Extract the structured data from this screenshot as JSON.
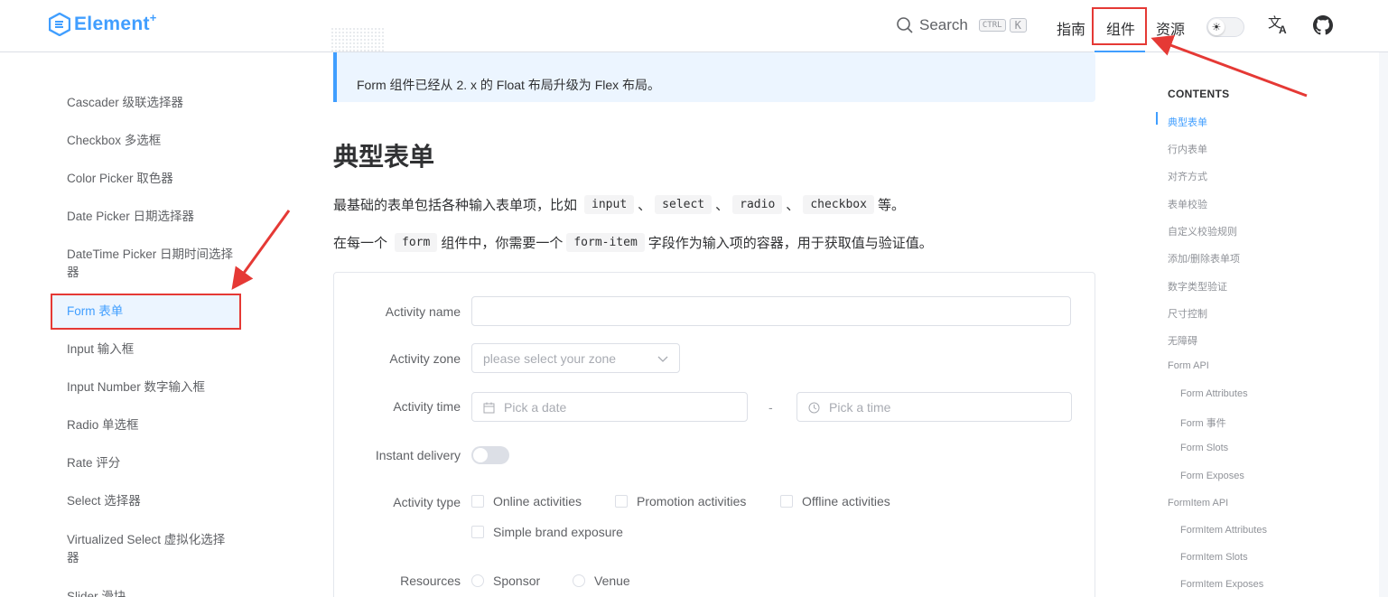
{
  "header": {
    "logo_text": "Element",
    "logo_plus": "+",
    "search_label": "Search",
    "kbd_ctrl": "CTRL",
    "kbd_k": "K",
    "nav": [
      "指南",
      "组件",
      "资源"
    ],
    "active_nav": "组件"
  },
  "sidebar": {
    "items": [
      "Cascader 级联选择器",
      "Checkbox 多选框",
      "Color Picker 取色器",
      "Date Picker 日期选择器",
      "DateTime Picker 日期时间选择器",
      "Form 表单",
      "Input 输入框",
      "Input Number 数字输入框",
      "Radio 单选框",
      "Rate 评分",
      "Select 选择器",
      "Virtualized Select 虚拟化选择器",
      "Slider 滑块"
    ],
    "active_item": "Form 表单"
  },
  "main": {
    "tip": "Form 组件已经从 2. x 的 Float 布局升级为 Flex 布局。",
    "heading": "典型表单",
    "para1_prefix": "最基础的表单包括各种输入表单项，比如",
    "para1_codes": [
      "input",
      "select",
      "radio",
      "checkbox"
    ],
    "para1_sep": "、",
    "para1_suffix": "等。",
    "para2_a": "在每一个",
    "para2_code1": "form",
    "para2_b": "组件中，你需要一个",
    "para2_code2": "form-item",
    "para2_c": "字段作为输入项的容器，用于获取值与验证值。"
  },
  "form": {
    "activity_name_label": "Activity name",
    "activity_name_value": "",
    "activity_zone_label": "Activity zone",
    "zone_placeholder": "please select your zone",
    "activity_time_label": "Activity time",
    "date_placeholder": "Pick a date",
    "time_separator": "-",
    "time_placeholder": "Pick a time",
    "instant_delivery_label": "Instant delivery",
    "instant_delivery_on": false,
    "activity_type_label": "Activity type",
    "types": [
      "Online activities",
      "Promotion activities",
      "Offline activities",
      "Simple brand exposure"
    ],
    "resources_label": "Resources",
    "resources": [
      "Sponsor",
      "Venue"
    ]
  },
  "toc": {
    "title": "CONTENTS",
    "items": [
      "典型表单",
      "行内表单",
      "对齐方式",
      "表单校验",
      "自定义校验规则",
      "添加/删除表单项",
      "数字类型验证",
      "尺寸控制",
      "无障碍",
      "Form API"
    ],
    "sub_form_api": [
      "Form Attributes",
      "Form 事件",
      "Form Slots",
      "Form Exposes"
    ],
    "formitem_api": "FormItem API",
    "sub_formitem_api": [
      "FormItem Attributes",
      "FormItem Slots",
      "FormItem Exposes"
    ],
    "active": "典型表单"
  },
  "colors": {
    "accent": "#409eff",
    "annotation": "#e53935"
  }
}
